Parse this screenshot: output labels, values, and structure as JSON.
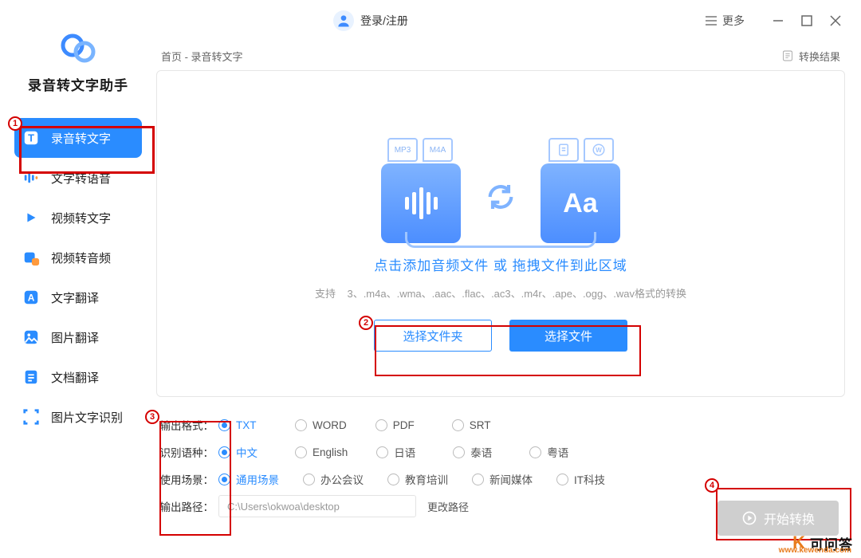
{
  "titlebar": {
    "login_text": "登录/注册",
    "more_text": "更多"
  },
  "app": {
    "name": "录音转文字助手"
  },
  "sidebar": {
    "items": [
      {
        "label": "录音转文字"
      },
      {
        "label": "文字转语音"
      },
      {
        "label": "视频转文字"
      },
      {
        "label": "视频转音频"
      },
      {
        "label": "文字翻译"
      },
      {
        "label": "图片翻译"
      },
      {
        "label": "文档翻译"
      },
      {
        "label": "图片文字识别"
      }
    ]
  },
  "crumbs": {
    "text": "首页 - 录音转文字",
    "result": "转换结果"
  },
  "drop": {
    "title": "点击添加音频文件 或 拖拽文件到此区域",
    "sub_prefix": "支持",
    "sub_formats": "3、.m4a、.wma、.aac、.flac、.ac3、.m4r、.ape、.ogg、.wav格式的转换",
    "btn_folder": "选择文件夹",
    "btn_file": "选择文件",
    "illus_tags": [
      "MP3",
      "M4A",
      "",
      ""
    ]
  },
  "options": {
    "format": {
      "label": "输出格式：",
      "items": [
        "TXT",
        "WORD",
        "PDF",
        "SRT"
      ],
      "selected": 0
    },
    "lang": {
      "label": "识别语种：",
      "items": [
        "中文",
        "English",
        "日语",
        "泰语",
        "粤语"
      ],
      "selected": 0
    },
    "scene": {
      "label": "使用场景：",
      "items": [
        "通用场景",
        "办公会议",
        "教育培训",
        "新闻媒体",
        "IT科技"
      ],
      "selected": 0
    },
    "path": {
      "label": "输出路径：",
      "value": "C:\\Users\\okwoa\\desktop",
      "change": "更改路径"
    }
  },
  "start_btn": "开始转换",
  "watermark": {
    "brand_k": "K",
    "brand_rest": "",
    "cn": "可问答",
    "url": "www.kewenda.com"
  }
}
